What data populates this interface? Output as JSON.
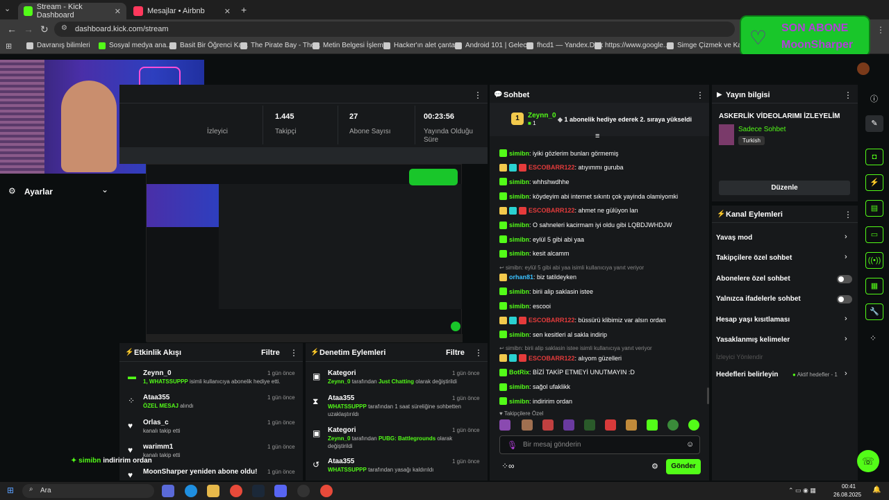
{
  "tabs": [
    {
      "label": "Stream - Kick Dashboard",
      "close": "✕"
    },
    {
      "label": "Mesajlar • Airbnb",
      "close": "✕"
    }
  ],
  "new_tab": "+",
  "url": "dashboard.kick.com/stream",
  "bookmarks": [
    "Davranış bilimleri",
    "Sosyal medya ana...",
    "Basit Bir Öğrenci Ka...",
    "The Pirate Bay - The...",
    "Metin Belgesi İşlemi...",
    "Hacker'ın alet çanta...",
    "Android 101 | Gelec...",
    "fhcd1 — Yandex.Disk",
    "https://www.google...",
    "Simge Çizmek ve Ka..."
  ],
  "son_abone": {
    "title": "SON ABONE",
    "name": "MoonSharper"
  },
  "stats": [
    {
      "value": "",
      "label": "İzleyici"
    },
    {
      "value": "1.445",
      "label": "Takipçi"
    },
    {
      "value": "27",
      "label": "Abone Sayısı"
    },
    {
      "value": "00:23:56",
      "label": "Yayında Olduğu Süre"
    }
  ],
  "sidebar": {
    "settings_label": "Ayarlar"
  },
  "chat": {
    "title": "Sohbet",
    "pinned_user": "Zeynn_0",
    "pinned_count": "1",
    "pinned_text": "1 abonelik hediye ederek 2. sıraya yükseldi",
    "placeholder": "Bir mesaj gönderin",
    "send_label": "Gönder",
    "followers_only": "Takipçilere Özel",
    "messages": [
      {
        "user": "simibn",
        "text": ": iyiki gözlerim bunları görmemiş",
        "color": "g"
      },
      {
        "user": "ESCOBARR122",
        "text": ": atıyımmı guruba",
        "color": "r"
      },
      {
        "user": "simibn",
        "text": ": whhshwdhhe",
        "color": "g"
      },
      {
        "user": "simibn",
        "text": ": köydeyim abi internet sıkıntı çok yayinda olamiyomki",
        "color": "g"
      },
      {
        "user": "ESCOBARR122",
        "text": ": ahmet ne gülüyon lan",
        "color": "r"
      },
      {
        "user": "simibn",
        "text": ": O sahneleri kacirmam iyi oldu gibi LQBDJWHDJW",
        "color": "g"
      },
      {
        "user": "simibn",
        "text": ": eylül 5 gibi abi yaa",
        "color": "g"
      },
      {
        "user": "simibn",
        "text": ": kesit alcamm",
        "color": "g"
      },
      {
        "reply": "simibn: eylül 5 gibi abi yaa isimli kullanıcıya yanıt veriyor"
      },
      {
        "user": "orhan81",
        "text": ": biz tatildeyken",
        "color": "b"
      },
      {
        "user": "simibn",
        "text": ": birii alip saklasin istee",
        "color": "g"
      },
      {
        "user": "simibn",
        "text": ": escooi",
        "color": "g"
      },
      {
        "user": "ESCOBARR122",
        "text": ": büssürü klibimiz var alsın ordan",
        "color": "r"
      },
      {
        "user": "simibn",
        "text": ": sen kesitleri al sakla indirip",
        "color": "g"
      },
      {
        "reply": "simibn: birii alip saklasin istee isimli kullanıcıya yanıt veriyor"
      },
      {
        "user": "ESCOBARR122",
        "text": ": alıyom güzelleri",
        "color": "r"
      },
      {
        "user": "BotRix",
        "text": ": BİZİ TAKİP ETMEYİ UNUTMAYIN :D",
        "color": "g"
      },
      {
        "user": "simibn",
        "text": ": sağol ufaklikk",
        "color": "g"
      },
      {
        "user": "simibn",
        "text": ": indiririm ordan",
        "color": "g"
      }
    ]
  },
  "stream_info": {
    "title": "Yayın bilgisi",
    "stream_title": "ASKERLİK VİDEOLARIMI İZLEYELİM",
    "category": "Sadece Sohbet",
    "language": "Turkish",
    "edit_label": "Düzenle"
  },
  "channel_actions": {
    "title": "Kanal Eylemleri",
    "rows": [
      {
        "label": "Yavaş mod",
        "type": "chevron"
      },
      {
        "label": "Takipçilere özel sohbet",
        "type": "chevron"
      },
      {
        "label": "Abonelere özel sohbet",
        "type": "toggle"
      },
      {
        "label": "Yalnızca ifadelerle sohbet",
        "type": "toggle"
      },
      {
        "label": "Hesap yaşı kısıtlaması",
        "type": "chevron"
      },
      {
        "label": "Yasaklanmış kelimeler",
        "type": "chevron"
      }
    ],
    "viewer_redirect": "İzleyici Yönlendir",
    "goals_label": "Hedefleri belirleyin",
    "goals_status": "Aktif hedefler - 1"
  },
  "activity": {
    "title": "Etkinlik Akışı",
    "filter": "Filtre",
    "items": [
      {
        "name": "Zeynn_0",
        "desc_strong": "1, WHATSSUPPP",
        "desc": " isimli kullanıcıya abonelik hediye etti.",
        "time": "1 gün önce"
      },
      {
        "name": "Ataa355",
        "desc_strong": "ÖZEL MESAJ",
        "desc": " alındı",
        "time": "1 gün önce"
      },
      {
        "name": "Orlas_c",
        "desc_strong": "",
        "desc": "kanalı takip etti",
        "time": "1 gün önce"
      },
      {
        "name": "warimm1",
        "desc_strong": "",
        "desc": "kanalı takip etti",
        "time": "1 gün önce"
      },
      {
        "name": "MoonSharper yeniden abone oldu!",
        "desc_strong": "",
        "desc": "",
        "time": "1 gün önce"
      }
    ]
  },
  "moderation": {
    "title": "Denetim Eylemleri",
    "filter": "Filtre",
    "items": [
      {
        "name": "Kategori",
        "l1a": "Zeynn_0",
        "l1b": " tarafından ",
        "l1c": "Just Chatting",
        "l1d": " olarak değiştirildi",
        "l2": "",
        "time": "1 gün önce"
      },
      {
        "name": "Ataa355",
        "l1a": "WHATSSUPPP",
        "l1b": " tarafından 1 saat süreliğine sohbetten",
        "l1c": "",
        "l1d": "",
        "l2": "uzaklaştırıldı",
        "time": "1 gün önce"
      },
      {
        "name": "Kategori",
        "l1a": "Zeynn_0",
        "l1b": " tarafından ",
        "l1c": "PUBG: Battlegrounds",
        "l1d": " olarak",
        "l2": "değiştirildi",
        "time": "1 gün önce"
      },
      {
        "name": "Ataa355",
        "l1a": "WHATSSUPPP",
        "l1b": " tarafından yasağı kaldırıldı",
        "l1c": "",
        "l1d": "",
        "l2": "",
        "time": "1 gün önce"
      }
    ]
  },
  "overlay_chat": {
    "user": "simibn",
    "text": "indiririm ordan"
  },
  "taskbar": {
    "search": "Ara",
    "time": "00:41",
    "date": "26.08.2025"
  },
  "colors": {
    "kick_green": "#53fc18",
    "panel": "#17191b",
    "accent_red": "#e53b3b"
  }
}
